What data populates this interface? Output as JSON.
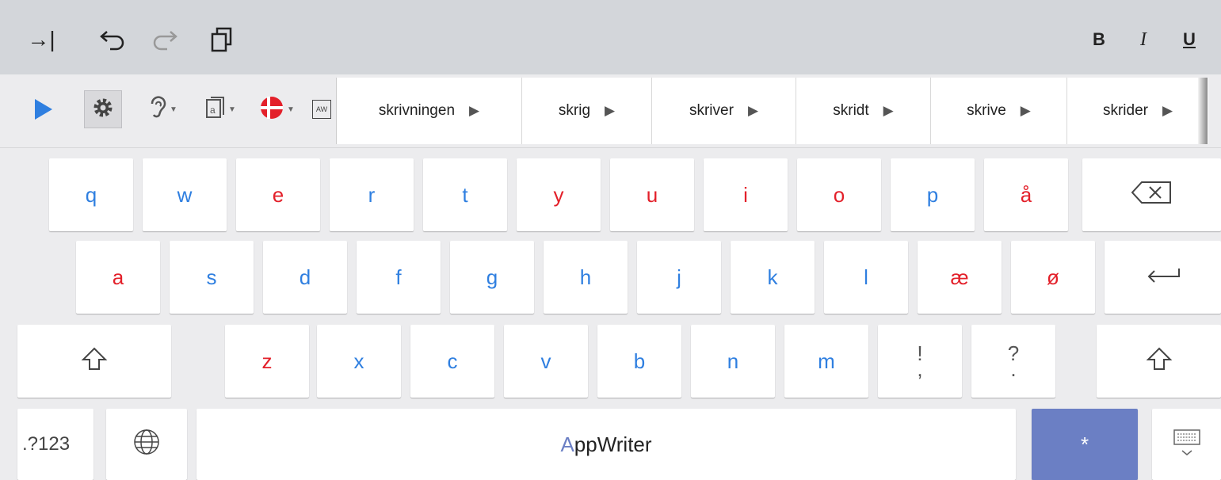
{
  "toolbar": {
    "tab_icon": "→|",
    "undo_icon": "⮌",
    "redo_icon": "⮎",
    "copy_icon": "⧉",
    "bold_label": "B",
    "italic_label": "I",
    "underline_label": "U"
  },
  "tools": {
    "play_icon": "play-icon",
    "settings_icon": "gear-icon",
    "ear_icon": "ear-icon",
    "doc_icon": "document-icon",
    "flag_icon": "danish-flag-icon",
    "aw_label": "AW"
  },
  "suggestions": [
    "skrivningen",
    "skrig",
    "skriver",
    "skridt",
    "skrive",
    "skrider"
  ],
  "keyboard": {
    "row1": [
      {
        "label": "q",
        "color": "blue"
      },
      {
        "label": "w",
        "color": "blue"
      },
      {
        "label": "e",
        "color": "red"
      },
      {
        "label": "r",
        "color": "blue"
      },
      {
        "label": "t",
        "color": "blue"
      },
      {
        "label": "y",
        "color": "red"
      },
      {
        "label": "u",
        "color": "red"
      },
      {
        "label": "i",
        "color": "red"
      },
      {
        "label": "o",
        "color": "red"
      },
      {
        "label": "p",
        "color": "blue"
      },
      {
        "label": "å",
        "color": "red"
      }
    ],
    "row2": [
      {
        "label": "a",
        "color": "red"
      },
      {
        "label": "s",
        "color": "blue"
      },
      {
        "label": "d",
        "color": "blue"
      },
      {
        "label": "f",
        "color": "blue"
      },
      {
        "label": "g",
        "color": "blue"
      },
      {
        "label": "h",
        "color": "blue"
      },
      {
        "label": "j",
        "color": "blue"
      },
      {
        "label": "k",
        "color": "blue"
      },
      {
        "label": "l",
        "color": "blue"
      },
      {
        "label": "æ",
        "color": "red"
      },
      {
        "label": "ø",
        "color": "red"
      }
    ],
    "row3": [
      {
        "label": "z",
        "color": "red"
      },
      {
        "label": "x",
        "color": "blue"
      },
      {
        "label": "c",
        "color": "blue"
      },
      {
        "label": "v",
        "color": "blue"
      },
      {
        "label": "b",
        "color": "blue"
      },
      {
        "label": "n",
        "color": "blue"
      },
      {
        "label": "m",
        "color": "blue"
      }
    ],
    "punct1": {
      "top": "!",
      "bottom": ","
    },
    "punct2": {
      "top": "?",
      "bottom": "."
    },
    "backspace_icon": "⌫",
    "enter_icon": "↵",
    "shift_icon": "⇧",
    "numbers_label": ".?123",
    "globe_icon": "globe-icon",
    "space_label_a": "A",
    "space_label_rest": "ppWriter",
    "star_label": "*",
    "hide_keyboard_icon": "keyboard-hide-icon",
    "accent_colors": {
      "blue": "#2f7fe0",
      "red": "#e3202a",
      "star_bg": "#6b7fc4",
      "appwriter_a": "#6b7fc4"
    }
  }
}
